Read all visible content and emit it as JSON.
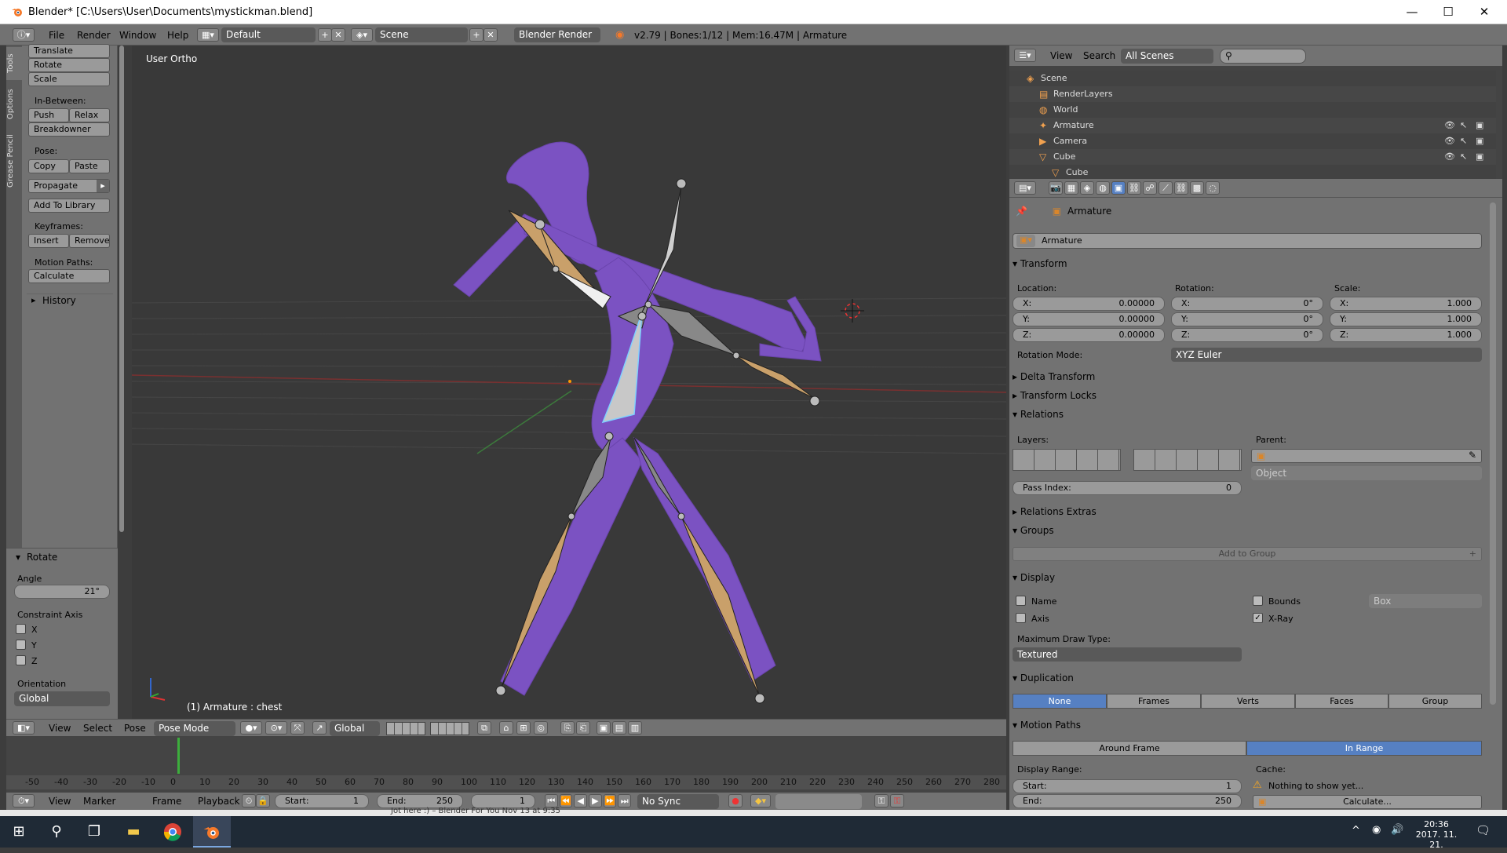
{
  "window": {
    "title": "Blender* [C:\\Users\\User\\Documents\\mystickman.blend]",
    "minimize": "—",
    "maximize": "☐",
    "close": "✕"
  },
  "infobar": {
    "menus": [
      "File",
      "Render",
      "Window",
      "Help"
    ],
    "layout": "Default",
    "scene": "Scene",
    "engine": "Blender Render",
    "stats": "v2.79 | Bones:1/12 | Mem:16.47M | Armature"
  },
  "toolshelf": {
    "tabs": [
      "Tools",
      "Options",
      "Grease Pencil"
    ],
    "translate": "Translate",
    "rotate": "Rotate",
    "scale": "Scale",
    "in_between_label": "In-Between:",
    "push": "Push",
    "relax": "Relax",
    "breakdowner": "Breakdowner",
    "pose_label": "Pose:",
    "copy": "Copy",
    "paste": "Paste",
    "propagate": "Propagate",
    "add_to_library": "Add To Library",
    "keyframes_label": "Keyframes:",
    "insert": "Insert",
    "remove": "Remove",
    "motion_paths_label": "Motion Paths:",
    "calculate": "Calculate",
    "history": "History"
  },
  "operator_panel": {
    "title": "Rotate",
    "angle_label": "Angle",
    "angle_value": "21°",
    "constraint_axis_label": "Constraint Axis",
    "x": "X",
    "y": "Y",
    "z": "Z",
    "orientation_label": "Orientation",
    "orientation_value": "Global"
  },
  "viewport": {
    "view_name": "User Ortho",
    "active": "(1) Armature : chest"
  },
  "viewport_header": {
    "view": "View",
    "select": "Select",
    "pose": "Pose",
    "mode": "Pose Mode",
    "orientation": "Global"
  },
  "timeline": {
    "ticks": [
      "-50",
      "-40",
      "-30",
      "-20",
      "-10",
      "0",
      "10",
      "20",
      "30",
      "40",
      "50",
      "60",
      "70",
      "80",
      "90",
      "100",
      "110",
      "120",
      "130",
      "140",
      "150",
      "160",
      "170",
      "180",
      "190",
      "200",
      "210",
      "220",
      "230",
      "240",
      "250",
      "260",
      "270",
      "280"
    ],
    "menus": [
      "View",
      "Marker",
      "Frame",
      "Playback"
    ],
    "start_label": "Start:",
    "start_value": "1",
    "end_label": "End:",
    "end_value": "250",
    "current": "1",
    "sync": "No Sync",
    "under_text": "Jot here :) – Blender For You Nov 13 at 9:35"
  },
  "outliner": {
    "view": "View",
    "search": "Search",
    "filter": "All Scenes",
    "items": [
      {
        "label": "Scene"
      },
      {
        "label": "RenderLayers"
      },
      {
        "label": "World"
      },
      {
        "label": "Armature"
      },
      {
        "label": "Camera"
      },
      {
        "label": "Cube"
      },
      {
        "label": "Cube"
      }
    ]
  },
  "properties": {
    "breadcrumb": "Armature",
    "object_name": "Armature",
    "transform": "Transform",
    "location_label": "Location:",
    "rotation_label": "Rotation:",
    "scale_label": "Scale:",
    "loc": [
      {
        "axis": "X:",
        "value": "0.00000"
      },
      {
        "axis": "Y:",
        "value": "0.00000"
      },
      {
        "axis": "Z:",
        "value": "0.00000"
      }
    ],
    "rot": [
      {
        "axis": "X:",
        "value": "0°"
      },
      {
        "axis": "Y:",
        "value": "0°"
      },
      {
        "axis": "Z:",
        "value": "0°"
      }
    ],
    "scl": [
      {
        "axis": "X:",
        "value": "1.000"
      },
      {
        "axis": "Y:",
        "value": "1.000"
      },
      {
        "axis": "Z:",
        "value": "1.000"
      }
    ],
    "rotation_mode_label": "Rotation Mode:",
    "rotation_mode": "XYZ Euler",
    "delta_transform": "Delta Transform",
    "transform_locks": "Transform Locks",
    "relations": "Relations",
    "layers_label": "Layers:",
    "parent_label": "Parent:",
    "parent_type": "Object",
    "pass_index_label": "Pass Index:",
    "pass_index": "0",
    "relations_extras": "Relations Extras",
    "groups": "Groups",
    "add_to_group": "Add to Group",
    "display": "Display",
    "name": "Name",
    "axis": "Axis",
    "bounds": "Bounds",
    "bounds_type": "Box",
    "xray": "X-Ray",
    "max_draw_type_label": "Maximum Draw Type:",
    "max_draw_type": "Textured",
    "duplication": "Duplication",
    "dup_options": [
      "None",
      "Frames",
      "Verts",
      "Faces",
      "Group"
    ],
    "motion_paths": "Motion Paths",
    "mp_options": [
      "Around Frame",
      "In Range"
    ],
    "display_range_label": "Display Range:",
    "cache_label": "Cache:",
    "start_label": "Start:",
    "start_value": "1",
    "end_label": "End:",
    "end_value": "250",
    "nothing_to_show": "Nothing to show yet...",
    "calculate": "Calculate..."
  },
  "taskbar": {
    "time": "20:36",
    "date": "2017. 11. 21."
  }
}
